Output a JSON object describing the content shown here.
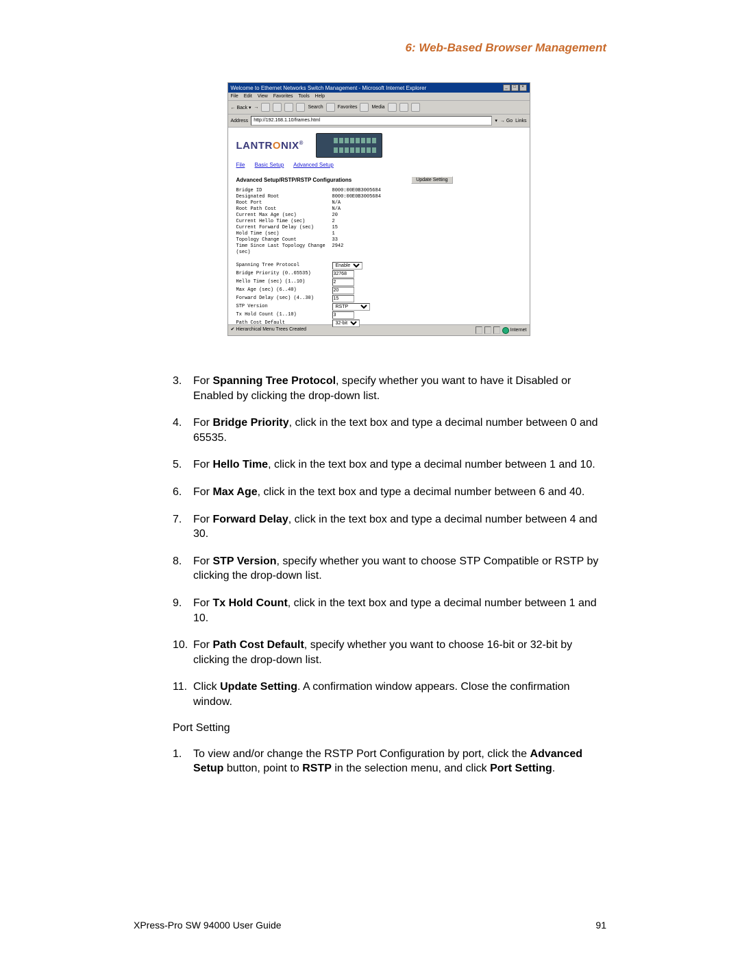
{
  "header": "6: Web-Based Browser Management",
  "footer": {
    "left": "XPress-Pro SW 94000 User Guide",
    "right": "91"
  },
  "screenshot": {
    "title": "Welcome to Ethernet Networks Switch Management - Microsoft Internet Explorer",
    "menus": [
      "File",
      "Edit",
      "View",
      "Favorites",
      "Tools",
      "Help"
    ],
    "toolbar_back": "Back",
    "toolbar_items": [
      "Search",
      "Favorites",
      "Media"
    ],
    "addr_label": "Address",
    "url": "http://192.168.1.10/frames.html",
    "go": "Go",
    "links": "Links",
    "logo": "LANTRONIX",
    "nav": [
      "File",
      "Basic Setup",
      "Advanced Setup"
    ],
    "content_title": "Advanced Setup/RSTP/RSTP Configurations",
    "update_btn": "Update Setting",
    "info_rows": [
      {
        "label": "Bridge ID",
        "value": "8000:00E0B3005684"
      },
      {
        "label": "Designated Root",
        "value": "8000:00E0B3005684"
      },
      {
        "label": "Root Port",
        "value": "N/A"
      },
      {
        "label": "Root Path Cost",
        "value": "N/A"
      },
      {
        "label": "Current Max Age (sec)",
        "value": "20"
      },
      {
        "label": "Current Hello Time (sec)",
        "value": "2"
      },
      {
        "label": "Current Forward Delay (sec)",
        "value": "15"
      },
      {
        "label": "Hold Time (sec)",
        "value": "1"
      },
      {
        "label": "Topology Change Count",
        "value": "33"
      },
      {
        "label": "Time Since Last Topology Change (sec)",
        "value": "2942"
      }
    ],
    "form_rows": [
      {
        "label": "Spanning Tree Protocol",
        "type": "select",
        "value": "Enable"
      },
      {
        "label": "Bridge Priority (0..65535)",
        "type": "input",
        "value": "32768"
      },
      {
        "label": "Hello Time (sec) (1..10)",
        "type": "input",
        "value": "2"
      },
      {
        "label": "Max Age (sec) (6..40)",
        "type": "input",
        "value": "20"
      },
      {
        "label": "Forward Delay (sec) (4..30)",
        "type": "input",
        "value": "15"
      },
      {
        "label": "STP Version",
        "type": "select",
        "value": "RSTP",
        "wide": true
      },
      {
        "label": "Tx Hold Count (1..10)",
        "type": "input",
        "value": "3"
      },
      {
        "label": "Path Cost Default",
        "type": "select",
        "value": "32-bit"
      }
    ],
    "status_left": "Hierarchical Menu Trees Created",
    "status_inet": "Internet"
  },
  "steps": [
    {
      "n": "3.",
      "html": "For <strong>Spanning Tree Protocol</strong>, specify whether you want to have it Disabled or Enabled by clicking the drop-down list."
    },
    {
      "n": "4.",
      "html": "For <strong>Bridge Priority</strong>, click in the text box and type a decimal number between 0 and 65535."
    },
    {
      "n": "5.",
      "html": "For <strong>Hello Time</strong>, click in the text box and type a decimal number between 1 and 10."
    },
    {
      "n": "6.",
      "html": "For <strong>Max Age</strong>, click in the text box and type a decimal number between 6 and 40."
    },
    {
      "n": "7.",
      "html": "For <strong>Forward Delay</strong>, click in the text box and type a decimal number between 4 and 30."
    },
    {
      "n": "8.",
      "html": "For <strong>STP Version</strong>, specify whether you want to choose STP Compatible or RSTP by clicking the drop-down list."
    },
    {
      "n": "9.",
      "html": "For <strong>Tx Hold Count</strong>, click in the text box and type a decimal number between 1 and 10."
    },
    {
      "n": "10.",
      "html": "For <strong>Path Cost Default</strong>, specify whether you want to choose 16-bit or 32-bit by clicking the drop-down list."
    },
    {
      "n": "11.",
      "html": "Click <strong>Update Setting</strong>. A confirmation window appears. Close the confirmation window."
    }
  ],
  "subheading": "Port Setting",
  "steps2": [
    {
      "n": "1.",
      "html": "To view and/or change the RSTP Port Configuration by port, click the <strong>Advanced Setup</strong> button, point to <strong>RSTP</strong> in the selection menu, and click <strong>Port Setting</strong>."
    }
  ]
}
